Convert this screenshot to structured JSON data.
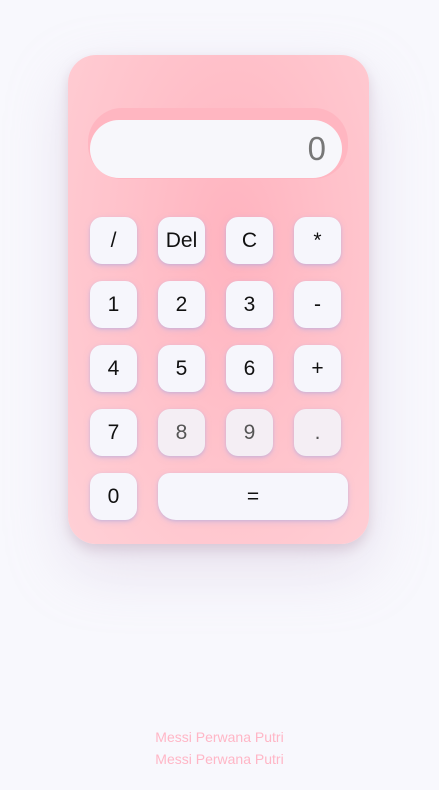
{
  "display": {
    "value": "0"
  },
  "keys": {
    "divide": "/",
    "delete": "Del",
    "clear": "C",
    "multiply": "*",
    "one": "1",
    "two": "2",
    "three": "3",
    "minus": "-",
    "four": "4",
    "five": "5",
    "six": "6",
    "plus": "+",
    "seven": "7",
    "eight": "8",
    "nine": "9",
    "decimal": ".",
    "zero": "0",
    "equals": "="
  },
  "footer": {
    "line1": "Messi Perwana Putri",
    "line2": "Messi Perwana Putri"
  },
  "colors": {
    "page_background": "#f8f8fd",
    "calculator_body": "#ffc1ca",
    "display_background": "#f7f7fb",
    "key_background": "#f6f6fc",
    "credit_text": "#ffb6c6"
  }
}
